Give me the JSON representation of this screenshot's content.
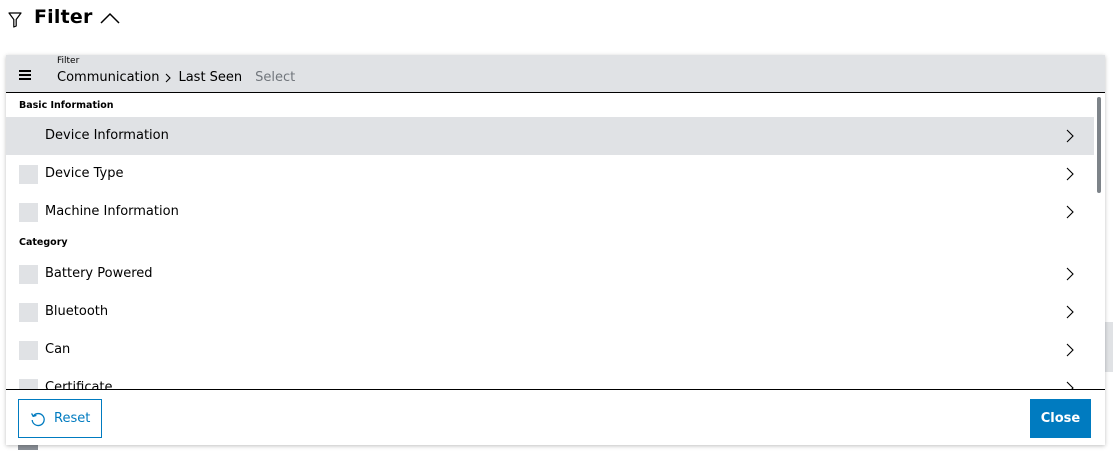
{
  "header": {
    "title": "Filter",
    "funnel_icon": "filter-icon",
    "collapse_icon": "chevron-up-icon"
  },
  "filter_field": {
    "label": "Filter",
    "menu_icon": "hamburger-menu-icon",
    "breadcrumb": [
      "Communication",
      "Last Seen"
    ],
    "placeholder": "Select"
  },
  "sections": [
    {
      "title": "Basic Information",
      "items": [
        {
          "label": "Device Information",
          "active": true
        },
        {
          "label": "Device Type",
          "active": false
        },
        {
          "label": "Machine Information",
          "active": false
        }
      ]
    },
    {
      "title": "Category",
      "items": [
        {
          "label": "Battery Powered",
          "active": false
        },
        {
          "label": "Bluetooth",
          "active": false
        },
        {
          "label": "Can",
          "active": false
        },
        {
          "label": "Certificate",
          "active": false
        }
      ]
    }
  ],
  "footer": {
    "reset_label": "Reset",
    "close_label": "Close"
  },
  "colors": {
    "accent": "#007bc0",
    "field_bg": "#e0e2e5",
    "placeholder": "#71767c"
  }
}
